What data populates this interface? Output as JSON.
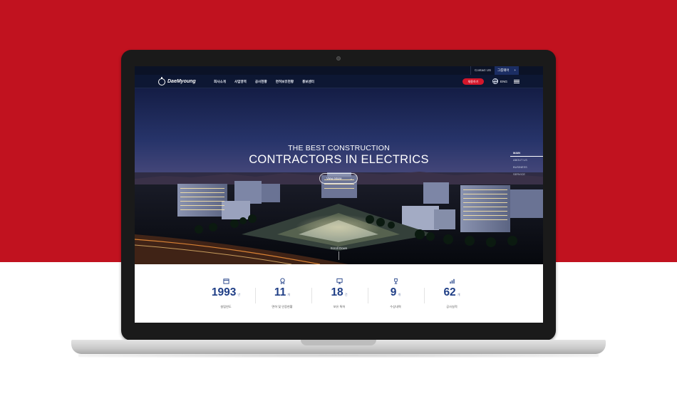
{
  "topbar": {
    "contact_label": "Contact US",
    "group_site_label": "그룹웨어",
    "group_site_plus": "+"
  },
  "nav": {
    "logo_text": "DaeMyoung",
    "menu": [
      "회사소개",
      "사업영역",
      "공사현황",
      "면허보유현황",
      "홍보센터"
    ],
    "hire_button": "채용하기",
    "lang": "ENG"
  },
  "hero": {
    "title_line1": "THE BEST CONSTRUCTION",
    "title_line2": "CONTRACTORS IN ELECTRICS",
    "view_more": "View More",
    "view_more_arrow": "→",
    "scroll_down": "Scroll Down",
    "side_nav": [
      "MAIN",
      "ABOUT US",
      "BUSINESS",
      "SERVICE"
    ]
  },
  "stats": [
    {
      "icon": "calendar-icon",
      "value": "1993",
      "unit": "년",
      "label": "설립연도"
    },
    {
      "icon": "award-icon",
      "value": "11",
      "unit": "개",
      "label": "면허 및 인증현황"
    },
    {
      "icon": "monitor-icon",
      "value": "18",
      "unit": "건",
      "label": "보유 특허"
    },
    {
      "icon": "trophy-icon",
      "value": "9",
      "unit": "개",
      "label": "수상내역"
    },
    {
      "icon": "chart-icon",
      "value": "62",
      "unit": "개",
      "label": "공사실적"
    }
  ],
  "colors": {
    "background_red": "#c1121f",
    "brand_navy": "#1f3e86",
    "accent_red": "#d4172b"
  }
}
